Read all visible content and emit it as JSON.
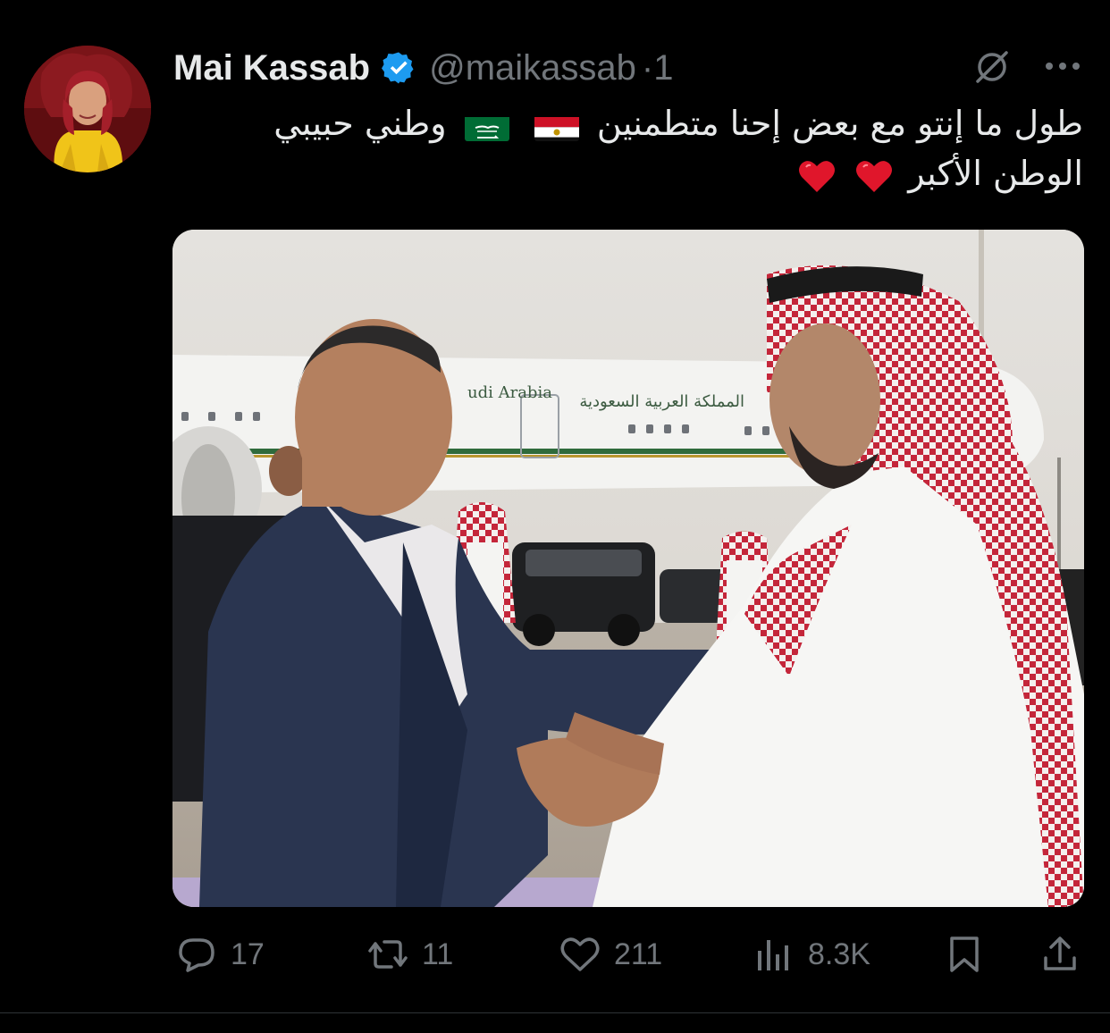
{
  "author": {
    "name": "Mai Kassab",
    "handle": "@maikassab",
    "separator": "·",
    "time_fragment": "1"
  },
  "tweet": {
    "line1": "طول ما إنتو مع بعض إحنا متطمنين",
    "line2": "وطني حبيبي",
    "line3": "الوطن الأكبر"
  },
  "icons": {
    "verified": "verified-badge-icon",
    "grok": "grok-icon",
    "more": "more-icon",
    "flag_egypt": "egypt-flag-icon",
    "flag_saudi": "saudi-flag-icon",
    "heart": "red-heart-emoji"
  },
  "media": {
    "alt_kind": "photo",
    "plane_text_en": "udi Arabia",
    "plane_text_ar": "المملكة العربية السعودية"
  },
  "actions": {
    "replies": "17",
    "reposts": "11",
    "likes": "211",
    "views": "8.3K"
  },
  "colors": {
    "background": "#000000",
    "text": "#e7e9ea",
    "secondary": "#71767b",
    "verified": "#1d9bf0",
    "heart": "#e0162b"
  }
}
